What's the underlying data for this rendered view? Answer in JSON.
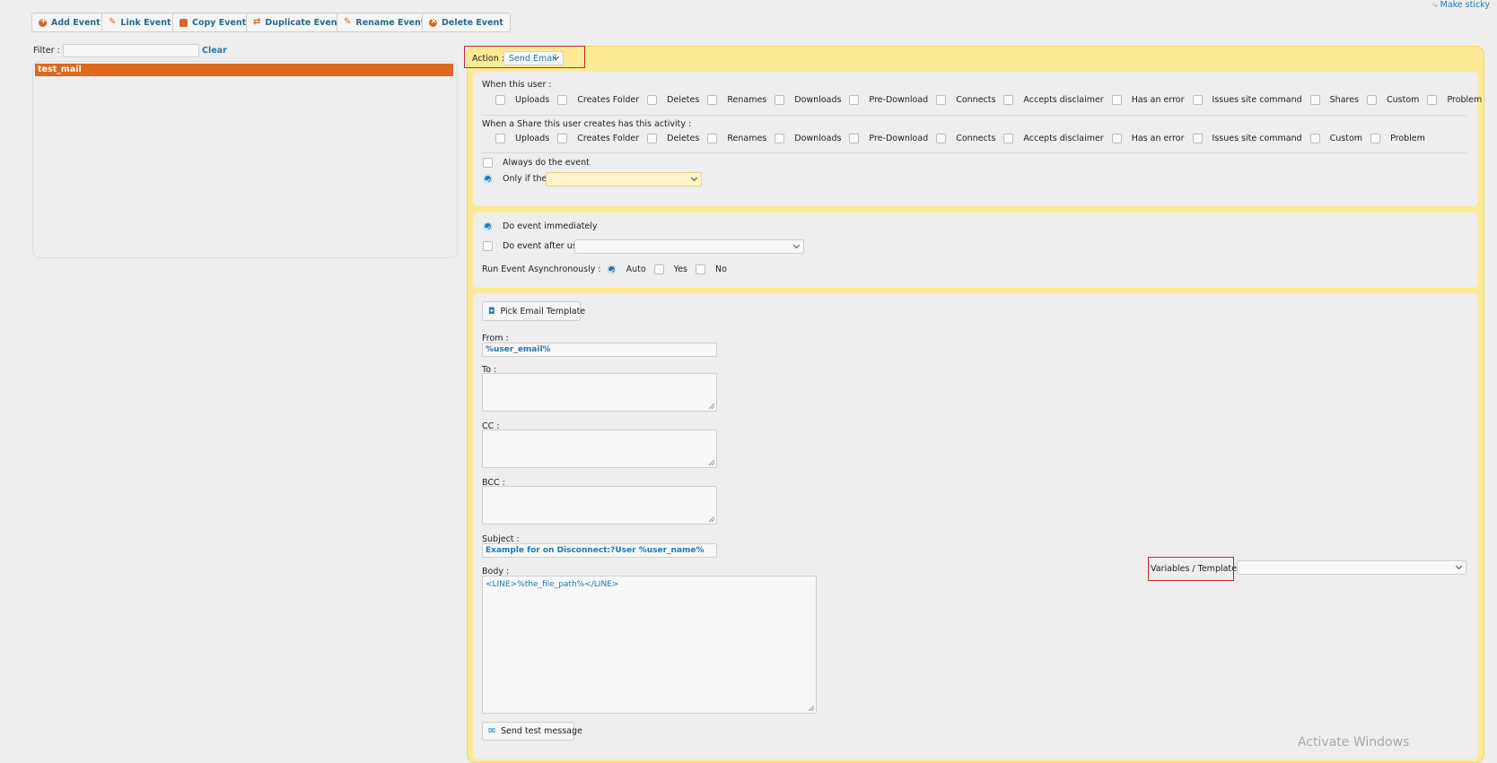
{
  "toolbar": {
    "add_event": "Add Event",
    "link_event": "Link Event",
    "copy_event": "Copy Event",
    "duplicate_event": "Duplicate Event",
    "rename_event": "Rename Event",
    "delete_event": "Delete Event"
  },
  "make_sticky": "Make sticky",
  "filter": {
    "label": "Filter :",
    "value": "",
    "clear": "Clear"
  },
  "events": [
    {
      "name": "test_mail",
      "selected": true
    }
  ],
  "action": {
    "label": "Action :",
    "value": "Send Email"
  },
  "when_user": {
    "heading": "When this user :",
    "options": [
      "Uploads",
      "Creates Folder",
      "Deletes",
      "Renames",
      "Downloads",
      "Pre-Download",
      "Connects",
      "Accepts disclaimer",
      "Has an error",
      "Issues site command",
      "Shares",
      "Custom",
      "Problem"
    ]
  },
  "when_share": {
    "heading": "When a Share this user creates has this activity :",
    "options": [
      "Uploads",
      "Creates Folder",
      "Deletes",
      "Renames",
      "Downloads",
      "Pre-Download",
      "Connects",
      "Accepts disclaimer",
      "Has an error",
      "Issues site command",
      "Custom",
      "Problem"
    ]
  },
  "condition": {
    "always": "Always do the event",
    "only_if": "Only if they",
    "selected": "only_if",
    "only_if_value": ""
  },
  "timing": {
    "immediately": "Do event immediately",
    "after_user": "Do event after user",
    "selected": "immediately",
    "after_user_value": "",
    "async_label": "Run Event Asynchronously :",
    "async_options": [
      "Auto",
      "Yes",
      "No"
    ],
    "async_selected": "Auto"
  },
  "email": {
    "pick_template": "Pick Email Template",
    "from_label": "From :",
    "from_value": "%user_email%",
    "to_label": "To :",
    "to_value": "",
    "cc_label": "CC :",
    "cc_value": "",
    "bcc_label": "BCC :",
    "bcc_value": "",
    "subject_label": "Subject :",
    "subject_value": "Example for on Disconnect:?User %user_name%",
    "body_label": "Body :",
    "body_value": "<LINE>%the_file_path%</LINE>",
    "variables_label": "Variables / Templates",
    "variables_value": "",
    "send_test": "Send test message"
  },
  "watermark": "Activate Windows",
  "colors": {
    "accent": "#1f7ab0",
    "selected_row": "#e0671f",
    "action_frame": "#fbeb95",
    "highlight_box": "#c0272d"
  }
}
